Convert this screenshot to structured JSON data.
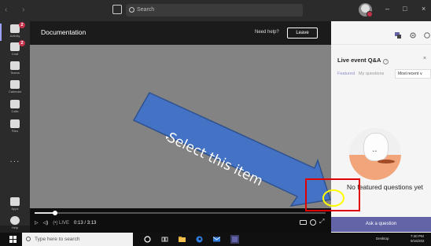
{
  "titlebar": {
    "nav": "‹  ›",
    "search_placeholder": "Search",
    "window_controls": [
      "–",
      "□",
      "×"
    ]
  },
  "rail": {
    "items": [
      {
        "label": "Activity",
        "icon": "bell-icon",
        "badge": "2"
      },
      {
        "label": "Chat",
        "icon": "chat-icon",
        "badge": "2"
      },
      {
        "label": "Teams",
        "icon": "teams-icon",
        "badge": ""
      },
      {
        "label": "Calendar",
        "icon": "calendar-icon",
        "badge": ""
      },
      {
        "label": "Calls",
        "icon": "phone-icon",
        "badge": ""
      },
      {
        "label": "Files",
        "icon": "file-icon",
        "badge": ""
      }
    ],
    "more": "···",
    "bottom": [
      {
        "label": "Apps",
        "icon": "apps-icon"
      },
      {
        "label": "Help",
        "icon": "help-icon"
      }
    ]
  },
  "meeting": {
    "title": "Documentation",
    "need_help": "Need help?",
    "leave": "Leave"
  },
  "controls": {
    "play": "▷",
    "volume": "◁)",
    "live": "(•) LIVE",
    "time": "0:13 / 3:13",
    "progress_fraction": 0.07
  },
  "panel": {
    "title": "Live event Q&A",
    "help": "?",
    "close": "×",
    "tabs": [
      "Featured",
      "My questions"
    ],
    "sort": "Most recent ∨",
    "empty_text": "No featured questions yet",
    "ask_button": "Ask a question"
  },
  "taskbar": {
    "search_placeholder": "Type here to search",
    "desktop_label": "Desktop",
    "time": "7:40 PM",
    "date": "9/16/202"
  },
  "annotation": {
    "text": "Select this item",
    "arrow_color": "#4472c4",
    "box_color": "#e00000",
    "circle_color": "#ffff00"
  },
  "colors": {
    "accent": "#6264a7",
    "badge": "#c4314b"
  }
}
